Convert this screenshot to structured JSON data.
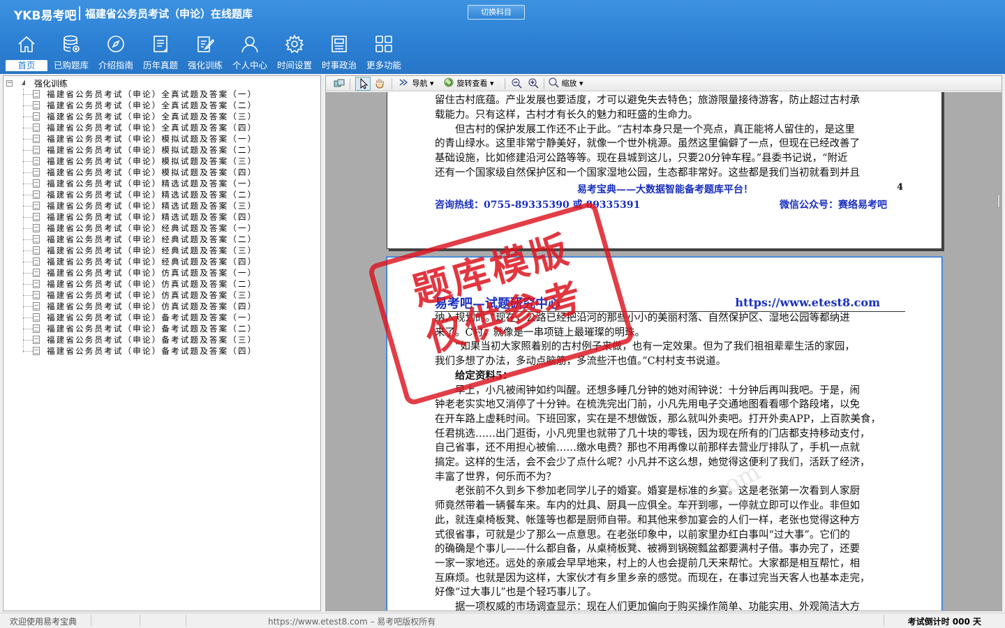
{
  "header": {
    "logo": "YKB易考吧",
    "app_title": "福建省公务员考试（申论）在线题库",
    "switch_button": "切换科目"
  },
  "nav": [
    {
      "label": "首页",
      "icon": "home-icon",
      "active": true
    },
    {
      "label": "已购题库",
      "icon": "database-icon"
    },
    {
      "label": "介绍指南",
      "icon": "compass-icon"
    },
    {
      "label": "历年真题",
      "icon": "document-list-icon"
    },
    {
      "label": "强化训练",
      "icon": "edit-icon"
    },
    {
      "label": "个人中心",
      "icon": "user-icon"
    },
    {
      "label": "时间设置",
      "icon": "gear-icon"
    },
    {
      "label": "时事政治",
      "icon": "news-icon"
    },
    {
      "label": "更多功能",
      "icon": "grid-icon"
    }
  ],
  "tree": {
    "root": "强化训练",
    "items": [
      "福建省公务员考试（申论）全真试题及答案（一）",
      "福建省公务员考试（申论）全真试题及答案（二）",
      "福建省公务员考试（申论）全真试题及答案（三）",
      "福建省公务员考试（申论）全真试题及答案（四）",
      "福建省公务员考试（申论）模拟试题及答案（一）",
      "福建省公务员考试（申论）模拟试题及答案（二）",
      "福建省公务员考试（申论）模拟试题及答案（三）",
      "福建省公务员考试（申论）模拟试题及答案（四）",
      "福建省公务员考试（申论）精选试题及答案（一）",
      "福建省公务员考试（申论）精选试题及答案（二）",
      "福建省公务员考试（申论）精选试题及答案（三）",
      "福建省公务员考试（申论）精选试题及答案（四）",
      "福建省公务员考试（申论）经典试题及答案（一）",
      "福建省公务员考试（申论）经典试题及答案（二）",
      "福建省公务员考试（申论）经典试题及答案（三）",
      "福建省公务员考试（申论）经典试题及答案（四）",
      "福建省公务员考试（申论）仿真试题及答案（一）",
      "福建省公务员考试（申论）仿真试题及答案（二）",
      "福建省公务员考试（申论）仿真试题及答案（三）",
      "福建省公务员考试（申论）仿真试题及答案（四）",
      "福建省公务员考试（申论）备考试题及答案（一）",
      "福建省公务员考试（申论）备考试题及答案（二）",
      "福建省公务员考试（申论）备考试题及答案（三）",
      "福建省公务员考试（申论）备考试题及答案（四）"
    ]
  },
  "toolbar": {
    "nav_label": "导航",
    "rotate_label": "旋转查看",
    "zoom_label": "缩放"
  },
  "page1": {
    "lines": [
      "留住古村底蕴。产业发展也要适度，才可以避免失去特色；旅游限量接待游客，防止超过古村承",
      "载能力。只有这样，古村才有长久的魅力和旺盛的生命力。",
      "　　但古村的保护发展工作还不止于此。“古村本身只是一个亮点，真正能将人留住的，是这里",
      "的青山绿水。这里非常宁静美好，就像一个世外桃源。虽然这里偏僻了一点，但现在已经改善了",
      "基础设施，比如修建沿河公路等等。现在县城到这儿，只要20分钟车程。”县委书记说，“附近",
      "还有一个国家级自然保护区和一个国家湿地公园，生态都非常好。这些都是我们当初就看到并且"
    ],
    "footer_slogan": "易考宝典——大数据智能备考题库平台！",
    "page_number": "4",
    "footer_phone": "咨询热线：0755-89335390 或 89335391",
    "footer_wechat": "微信公众号：赛络易考吧"
  },
  "page2": {
    "header_left": "易考吧—试题研究中心",
    "header_right": "https://www.etest8.com",
    "lines": [
      "纳入规划的。”现在，公路已经把沿河的那些小小的美丽村落、自然保护区、湿地公园等都纳进",
      "来了。C村，就像是一串项链上最璀璨的明珠。",
      "　　“如果当初大家照着别的古村例子来做，也有一定效果。但为了我们祖祖辈辈生活的家园，",
      "我们多想了办法，多动点脑筋，多流些汗也值。”C村村支书说道。",
      "　　给定资料5：",
      "　　早上，小凡被闹钟如约叫醒。还想多睡几分钟的她对闹钟说：十分钟后再叫我吧。于是，闹",
      "钟老老实实地又消停了十分钟。在梳洗完出门前，小凡先用电子交通地图看看哪个路段堵，以免",
      "在开车路上虚耗时间。下班回家，实在是不想做饭，那么就叫外卖吧。打开外卖APP，上百款美食，",
      "任君挑选……出门逛街，小凡兜里也就带了几十块的零钱，因为现在所有的门店都支持移动支付，",
      "自己省事，还不用担心被偷……缴水电费？那也不用再像以前那样去营业厅排队了，手机一点就",
      "搞定。这样的生活，会不会少了点什么呢？小凡并不这么想，她觉得这便利了我们，活跃了经济，",
      "丰富了世界，何乐而不为？",
      "　　老张前不久到乡下参加老同学儿子的婚宴。婚宴是标准的乡宴。这是老张第一次看到人家厨",
      "师竟然带着一辆餐车来。车内的灶具、厨具一应俱全。车开到哪，一停就立即可以作业。非但如",
      "此，就连桌椅板凳、帐篷等也都是厨师自带。和其他来参加宴会的人们一样，老张也觉得这种方",
      "式很省事，可就是少了那么一点意思。在老张印象中，以前家里办红白事叫“过大事”。它们的",
      "的确确是个事儿——什么都自备，从桌椅板凳、被褥到锅碗瓢盆都要满村子借。事办完了，还要",
      "一家一家地还。远处的亲戚会早早地来，村上的人也会提前几天来帮忙。大家都是相互帮忙，相",
      "互麻烦。也就是因为这样，大家伙才有乡里乡亲的感觉。而现在，在事过完当天客人也基本走完，",
      "好像“过大事儿”也是个轻巧事儿了。",
      "　　据一项权威的市场调查显示：现在人们更加偏向于购买操作简单、功能实用、外观简洁大方"
    ]
  },
  "stamp": {
    "line1": "题库模版",
    "line2": "仅供参考"
  },
  "watermark": "www.etest8.com",
  "status": {
    "welcome": "欢迎使用易考宝典",
    "url": "https://www.etest8.com – 易考吧版权所有",
    "countdown": "考试倒计时 000 天"
  },
  "colors": {
    "header_blue": "#2b7fd3",
    "doc_blue": "#1a2fbf",
    "stamp_red": "#dc141e"
  }
}
